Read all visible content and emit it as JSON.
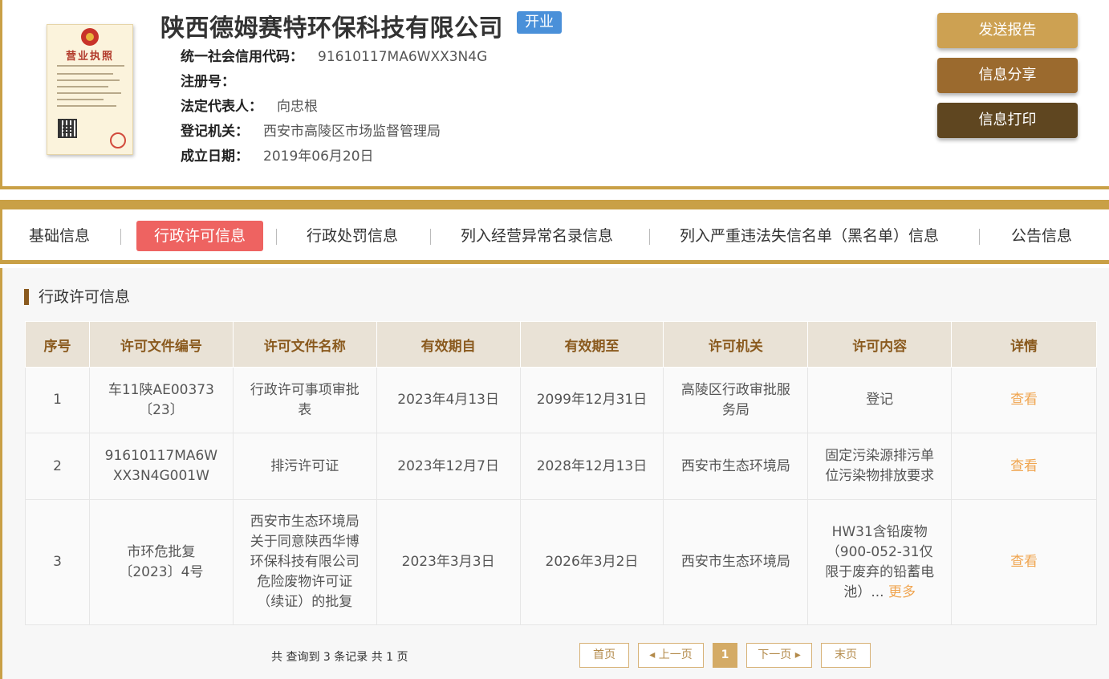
{
  "company": {
    "name": "陕西德姆赛特环保科技有限公司",
    "status": "开业",
    "license_title": "营业执照",
    "fields": [
      {
        "label": "统一社会信用代码：",
        "value": "91610117MA6WXX3N4G"
      },
      {
        "label": "注册号：",
        "value": ""
      },
      {
        "label": "法定代表人：",
        "value": "向忠根"
      },
      {
        "label": "登记机关：",
        "value": "西安市高陵区市场监督管理局"
      },
      {
        "label": "成立日期：",
        "value": "2019年06月20日"
      }
    ]
  },
  "actions": {
    "report": "发送报告",
    "share": "信息分享",
    "print": "信息打印"
  },
  "tabs": [
    "基础信息",
    "行政许可信息",
    "行政处罚信息",
    "列入经营异常名录信息",
    "列入严重违法失信名单（黑名单）信息",
    "公告信息"
  ],
  "active_tab": "行政许可信息",
  "section_title": "行政许可信息",
  "table": {
    "headers": [
      "序号",
      "许可文件编号",
      "许可文件名称",
      "有效期自",
      "有效期至",
      "许可机关",
      "许可内容",
      "详情"
    ],
    "rows": [
      [
        "1",
        "车11陕AE00373〔23〕",
        "行政许可事项审批表",
        "2023年4月13日",
        "2099年12月31日",
        "高陵区行政审批服务局",
        "登记",
        "查看"
      ],
      [
        "2",
        "91610117MA6WXX3N4G001W",
        "排污许可证",
        "2023年12月7日",
        "2028年12月13日",
        "西安市生态环境局",
        "固定污染源排污单位污染物排放要求",
        "查看"
      ],
      [
        "3",
        "市环危批复〔2023〕4号",
        "西安市生态环境局关于同意陕西华博环保科技有限公司危险废物许可证（续证）的批复",
        "2023年3月3日",
        "2026年3月2日",
        "西安市生态环境局",
        "HW31含铅废物（900-052-31仅限于废弃的铅蓄电池）...",
        "查看"
      ]
    ],
    "more_label": "更多"
  },
  "pagination": {
    "summary": "共 查询到 3 条记录 共 1 页",
    "first": "首页",
    "prev": "◂ 上一页",
    "current": "1",
    "next": "下一页 ▸",
    "last": "末页"
  },
  "colors": {
    "gold": "#c9a046",
    "active_tab": "#ee6361",
    "status_badge": "#4a90d9",
    "link": "#f0a550"
  }
}
